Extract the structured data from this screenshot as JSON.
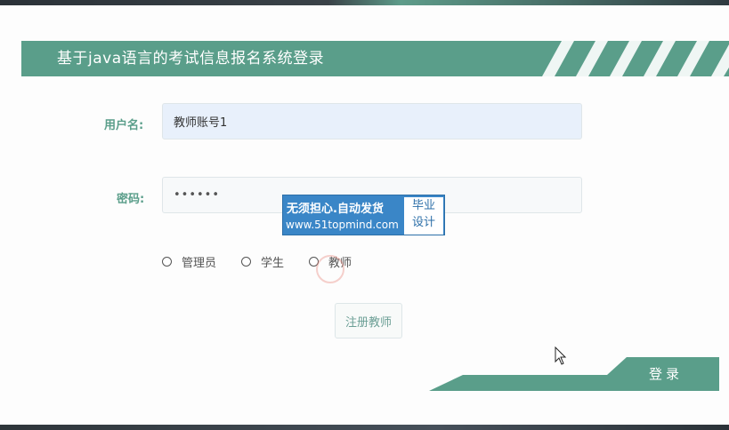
{
  "header": {
    "title": "基于java语言的考试信息报名系统登录"
  },
  "form": {
    "username_label": "用户名:",
    "username_value": "教师账号1",
    "password_label": "密码:",
    "password_value": "••••••",
    "roles": [
      {
        "label": "管理员",
        "selected": false
      },
      {
        "label": "学生",
        "selected": false
      },
      {
        "label": "教师",
        "selected": false
      }
    ],
    "register_label": "注册教师",
    "login_label": "登录"
  },
  "watermark": {
    "line1": "无须担心.自动发货",
    "line2": "www.51topmind.com",
    "badge_line1": "毕业",
    "badge_line2": "设计"
  },
  "colors": {
    "accent": "#5a9e8a",
    "watermark_blue": "#3a86c7"
  }
}
